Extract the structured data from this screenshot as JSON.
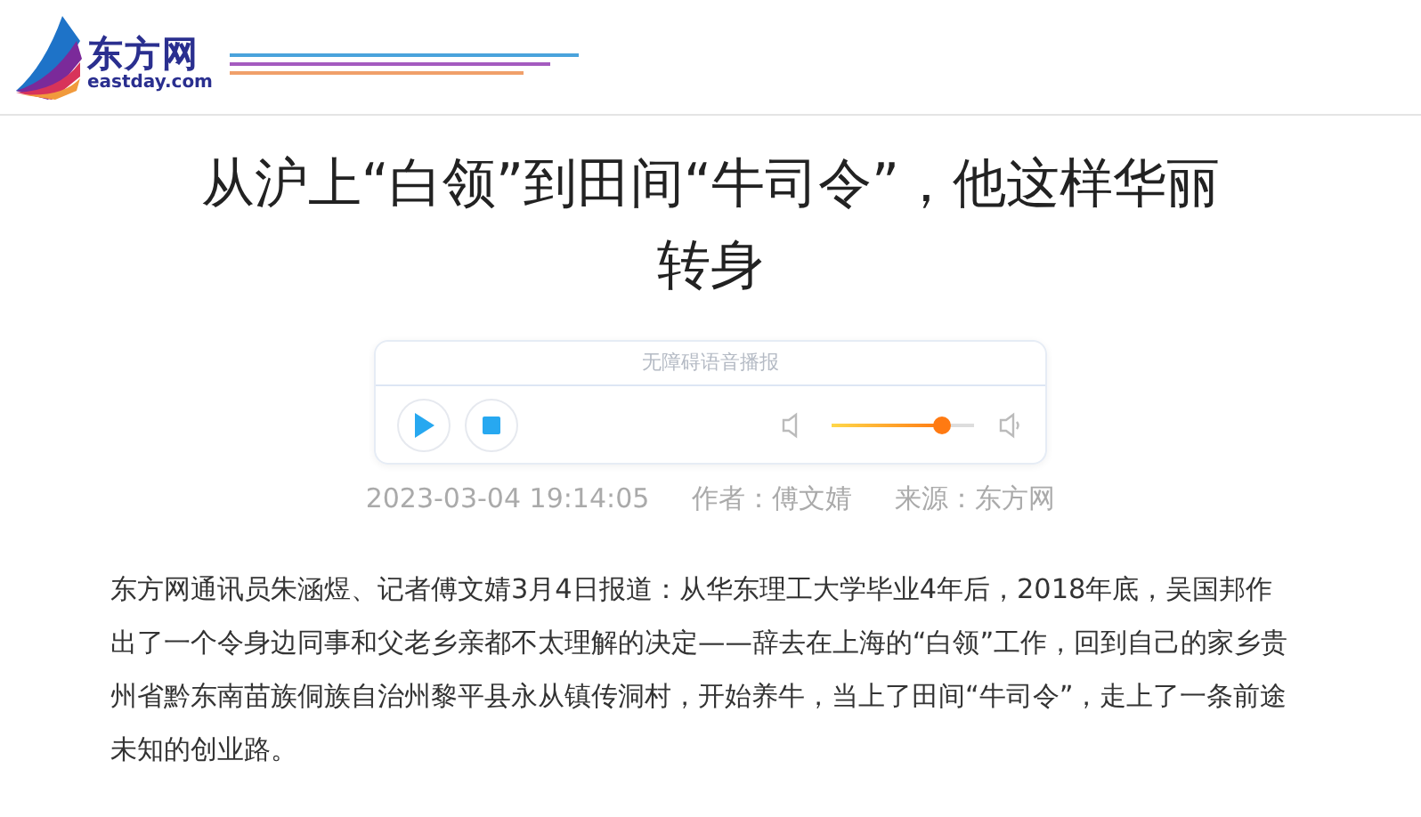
{
  "header": {
    "logo": {
      "name": "东方网",
      "domain": "eastday.com"
    }
  },
  "article": {
    "title": "从沪上“白领”到田间“牛司令”，他这样华丽转身",
    "player": {
      "label": "无障碍语音播报",
      "playing": false,
      "volume": {
        "level": 0.77
      }
    },
    "meta": {
      "time": "2023-03-04 19:14:05",
      "author": "作者：傅文婧",
      "source": "来源：东方网"
    },
    "paragraphs": [
      "东方网通讯员朱涵煜、记者傅文婧3月4日报道：从华东理工大学毕业4年后，2018年底，吴国邦作出了一个令身边同事和父老乡亲都不太理解的决定——辞去在上海的“白领”工作，回到自己的家乡贵州省黔东南苗族侗族自治州黎平县永从镇传洞村，开始养牛，当上了田间“牛司令”，走上了一条前途未知的创业路。"
    ]
  }
}
